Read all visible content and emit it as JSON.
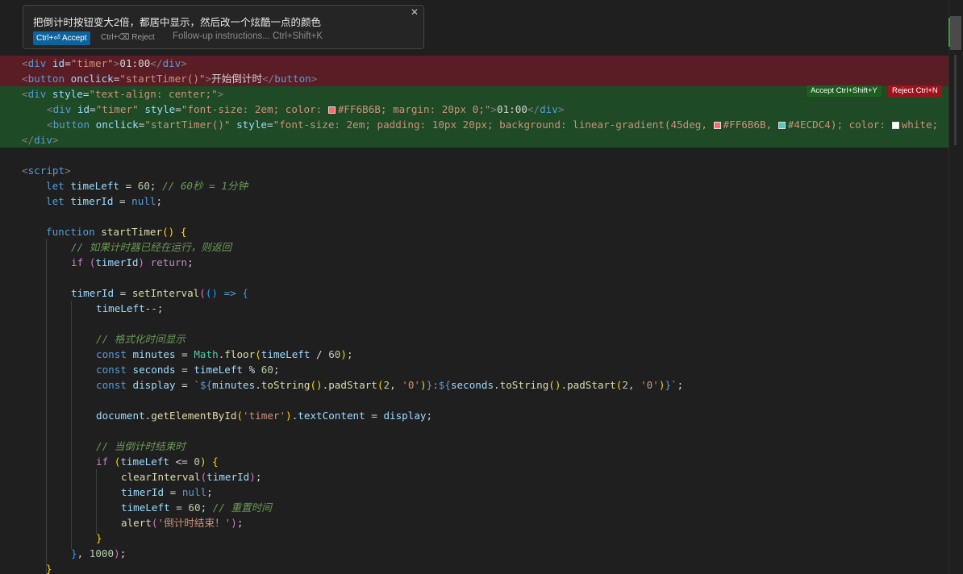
{
  "inline_chat": {
    "prompt": "把倒计时按钮变大2倍，都居中显示，然后改一个炫酷一点的颜色",
    "close_glyph": "✕",
    "accept_label": "Ctrl+⏎ Accept",
    "reject_label": "Ctrl+⌫ Reject",
    "followup_placeholder": "Follow-up instructions... Ctrl+Shift+K"
  },
  "diff_actions": {
    "accept_label": "Accept Ctrl+Shift+Y",
    "reject_label": "Reject Ctrl+N"
  },
  "swatch_colors": {
    "coral": "#FF6B6B",
    "teal": "#4ECDC4",
    "white": "#FFFFFF"
  },
  "code": {
    "l1": {
      "t1": "<",
      "t2": "div",
      "t3": " id",
      "t4": "=",
      "t5": "\"timer\"",
      "t6": ">",
      "t7": "01:00",
      "t8": "</",
      "t9": "div",
      "t10": ">"
    },
    "l2": {
      "t1": "<",
      "t2": "button",
      "t3": " onclick",
      "t4": "=",
      "t5": "\"startTimer()\"",
      "t6": ">",
      "t7": "开始倒计时",
      "t8": "</",
      "t9": "button",
      "t10": ">"
    },
    "l3": {
      "t1": "<",
      "t2": "div",
      "t3": " style",
      "t4": "=",
      "t5": "\"text-align: center;\"",
      "t6": ">"
    },
    "l4": {
      "t1": "<",
      "t2": "div",
      "t3": " id",
      "t4": "=",
      "t5": "\"timer\"",
      "t6": " style",
      "t7": "=",
      "t8": "\"font-size: 2em; color: ",
      "t9": "#FF6B6B; margin: 20px 0;\"",
      "t10": ">",
      "t11": "01:00",
      "t12": "</",
      "t13": "div",
      "t14": ">"
    },
    "l5": {
      "t1": "<",
      "t2": "button",
      "t3": " onclick",
      "t4": "=",
      "t5": "\"startTimer()\"",
      "t6": " style",
      "t7": "=",
      "t8": "\"font-size: 2em; padding: 10px 20px; background: linear-gradient(45deg, ",
      "t9": "#FF6B6B, ",
      "t10": "#4ECDC4); color: ",
      "t11": "white;"
    },
    "l6": {
      "t1": "</",
      "t2": "div",
      "t3": ">"
    },
    "l8": {
      "t1": "<",
      "t2": "script",
      "t3": ">"
    },
    "l9": {
      "t1": "let",
      "t2": " timeLeft",
      "t3": " = ",
      "t4": "60",
      "t5": "; ",
      "t6": "// 60秒 = 1分钟"
    },
    "l10": {
      "t1": "let",
      "t2": " timerId",
      "t3": " = ",
      "t4": "null",
      "t5": ";"
    },
    "l12": {
      "t1": "function",
      "t2": " startTimer",
      "t3": "()",
      "t4": " {"
    },
    "l13": {
      "t1": "// 如果计时器已经在运行，则返回"
    },
    "l14": {
      "t1": "if",
      "t2": " (",
      "t3": "timerId",
      "t4": ")",
      "t5": " return",
      "t6": ";"
    },
    "l16": {
      "t1": "timerId",
      "t2": " = ",
      "t3": "setInterval",
      "t4": "(",
      "t5": "()",
      "t6": " => ",
      "t7": "{"
    },
    "l17": {
      "t1": "timeLeft",
      "t2": "--;"
    },
    "l19": {
      "t1": "// 格式化时间显示"
    },
    "l20": {
      "t1": "const",
      "t2": " minutes",
      "t3": " = ",
      "t4": "Math",
      "t5": ".",
      "t6": "floor",
      "t7": "(",
      "t8": "timeLeft",
      "t9": " / ",
      "t10": "60",
      "t11": ")",
      "t12": ";"
    },
    "l21": {
      "t1": "const",
      "t2": " seconds",
      "t3": " = ",
      "t4": "timeLeft",
      "t5": " % ",
      "t6": "60",
      "t7": ";"
    },
    "l22": {
      "t1": "const",
      "t2": " display",
      "t3": " = ",
      "t4": "`",
      "t5": "${",
      "t6": "minutes",
      "t7": ".",
      "t8": "toString",
      "t9": "()",
      "t10": ".",
      "t11": "padStart",
      "t12": "(",
      "t13": "2",
      "t14": ", ",
      "t15": "'0'",
      "t16": ")",
      "t17": "}",
      "t18": ":",
      "t19": "${",
      "t20": "seconds",
      "t21": ".",
      "t22": "toString",
      "t23": "()",
      "t24": ".",
      "t25": "padStart",
      "t26": "(",
      "t27": "2",
      "t28": ", ",
      "t29": "'0'",
      "t30": ")",
      "t31": "}",
      "t32": "`",
      "t33": ";"
    },
    "l24": {
      "t1": "document",
      "t2": ".",
      "t3": "getElementById",
      "t4": "(",
      "t5": "'timer'",
      "t6": ")",
      "t7": ".",
      "t8": "textContent",
      "t9": " = ",
      "t10": "display",
      "t11": ";"
    },
    "l26": {
      "t1": "// 当倒计时结束时"
    },
    "l27": {
      "t1": "if",
      "t2": " (",
      "t3": "timeLeft",
      "t4": " <= ",
      "t5": "0",
      "t6": ")",
      "t7": " {"
    },
    "l28": {
      "t1": "clearInterval",
      "t2": "(",
      "t3": "timerId",
      "t4": ")",
      "t5": ";"
    },
    "l29": {
      "t1": "timerId",
      "t2": " = ",
      "t3": "null",
      "t4": ";"
    },
    "l30": {
      "t1": "timeLeft",
      "t2": " = ",
      "t3": "60",
      "t4": "; ",
      "t5": "// 重置时间"
    },
    "l31": {
      "t1": "alert",
      "t2": "(",
      "t3": "'倒计时结束！'",
      "t4": ")",
      "t5": ";"
    },
    "l32": {
      "t1": "}"
    },
    "l33": {
      "t1": "}",
      "t2": ", ",
      "t3": "1000",
      "t4": ")",
      "t5": ";"
    },
    "l34": {
      "t1": "}"
    }
  }
}
